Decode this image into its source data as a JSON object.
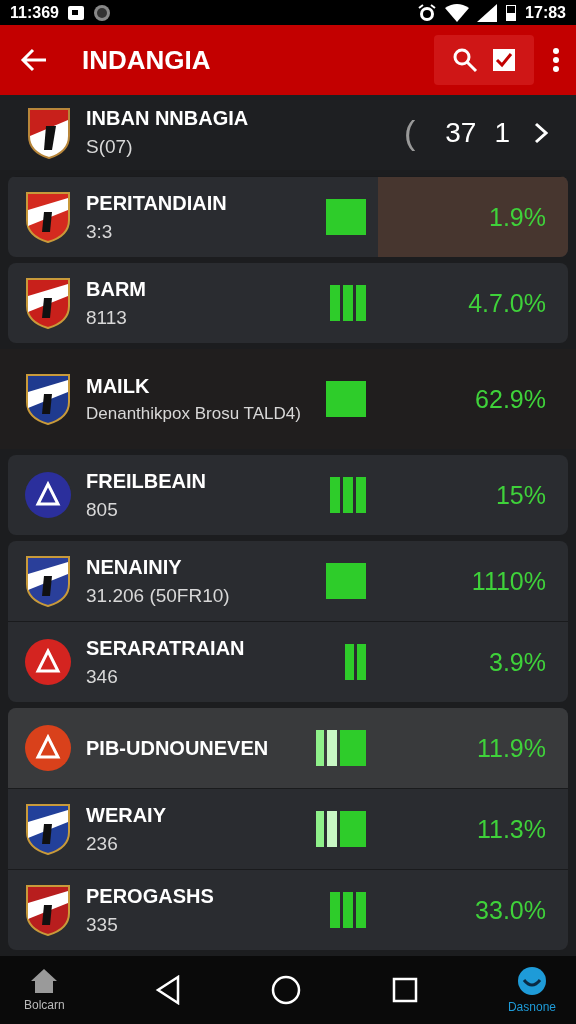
{
  "status_bar": {
    "time_left": "11:369",
    "time_right": "17:83"
  },
  "app_bar": {
    "title": "INDANGIA"
  },
  "header": {
    "name": "INBAN NNBAGIA",
    "sub": "S(07)",
    "bracket": "(",
    "score": "37",
    "count": "1"
  },
  "groups": [
    {
      "kind": "card",
      "highlighted": true,
      "rows": [
        {
          "name": "PERITANDIAIN",
          "sub": "3:3",
          "percent": "1.9%",
          "graph": {
            "kind": "block"
          },
          "badge": {
            "kind": "shield",
            "color": "#d42a1f"
          },
          "selected": false
        }
      ]
    },
    {
      "kind": "card",
      "highlighted": false,
      "rows": [
        {
          "name": "BARM",
          "sub": "8113",
          "percent": "4.7.0%",
          "graph": {
            "kind": "triple"
          },
          "badge": {
            "kind": "shield",
            "color": "#c8201b"
          },
          "selected": false
        }
      ]
    },
    {
      "kind": "plain",
      "highlighted": false,
      "rows": [
        {
          "name": "MAILK",
          "sub": "Denanthikpox Brosu TALD4)",
          "percent": "62.9%",
          "graph": {
            "kind": "block"
          },
          "badge": {
            "kind": "shield",
            "color": "#1f3a8f"
          },
          "selected": false
        }
      ]
    },
    {
      "kind": "card",
      "highlighted": false,
      "rows": [
        {
          "name": "FREILBEAIN",
          "sub": "805",
          "percent": "15%",
          "graph": {
            "kind": "triple"
          },
          "badge": {
            "kind": "circle",
            "color": "#2b2f9c"
          },
          "selected": false
        }
      ]
    },
    {
      "kind": "card",
      "highlighted": false,
      "rows": [
        {
          "name": "NENAINIY",
          "sub": "31.206 (50FR10)",
          "percent": "1110%",
          "graph": {
            "kind": "block"
          },
          "badge": {
            "kind": "shield",
            "color": "#2a3f9a"
          },
          "selected": false
        },
        {
          "name": "SERARATRAIAN",
          "sub": "346",
          "percent": "3.9%",
          "graph": {
            "kind": "double"
          },
          "badge": {
            "kind": "circle",
            "color": "#d42420"
          },
          "selected": false
        }
      ]
    },
    {
      "kind": "card",
      "highlighted": false,
      "rows": [
        {
          "name": "PIB-UDNOUNEVEN",
          "percent": "11.9%",
          "graph": {
            "kind": "split"
          },
          "badge": {
            "kind": "circle",
            "color": "#d9411b"
          },
          "selected": true
        },
        {
          "name": "WERAIY",
          "sub": "236",
          "percent": "11.3%",
          "graph": {
            "kind": "split"
          },
          "badge": {
            "kind": "shield",
            "color": "#22409a"
          },
          "selected": false
        },
        {
          "name": "PEROGASHS",
          "sub": "335",
          "percent": "33.0%",
          "graph": {
            "kind": "triple"
          },
          "badge": {
            "kind": "shield",
            "color": "#b81e1e"
          },
          "selected": false
        }
      ]
    }
  ],
  "nav": {
    "left_label": "Bolcarn",
    "right_label": "Dasnone"
  }
}
